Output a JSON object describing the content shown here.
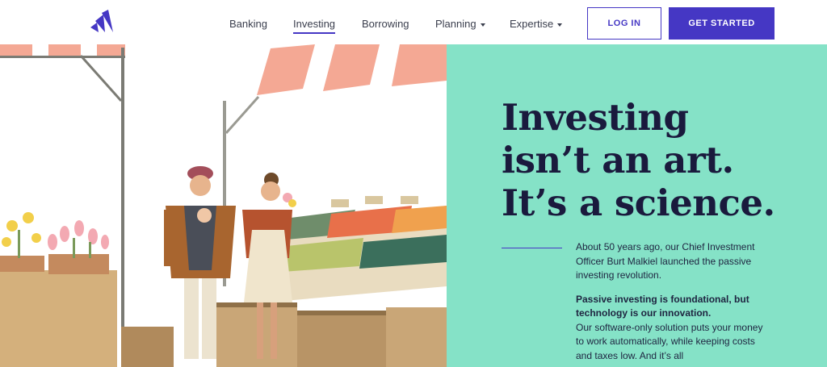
{
  "header": {
    "nav": [
      {
        "label": "Banking",
        "dropdown": false,
        "active": false
      },
      {
        "label": "Investing",
        "dropdown": false,
        "active": true
      },
      {
        "label": "Borrowing",
        "dropdown": false,
        "active": false
      },
      {
        "label": "Planning",
        "dropdown": true,
        "active": false
      },
      {
        "label": "Expertise",
        "dropdown": true,
        "active": false
      }
    ],
    "login_label": "LOG IN",
    "start_label": "GET STARTED"
  },
  "hero": {
    "headline_lines": [
      "Investing",
      "isn’t an art.",
      "It’s a science."
    ],
    "intro": "About 50 years ago, our Chief Investment Officer Burt Malkiel launched the passive investing revolution.",
    "emphasis": "Passive investing is foundational, but technology is our innovation.",
    "detail": "Our software-only solution puts your money to work automatically, while keeping costs and taxes low. And it’s all"
  },
  "colors": {
    "accent": "#4537c4",
    "panel": "#85e2c7",
    "headline": "#1a1a3d",
    "awning": "#f4a894"
  },
  "icons": [
    "wealthfront-logo",
    "chevron-down-icon"
  ]
}
